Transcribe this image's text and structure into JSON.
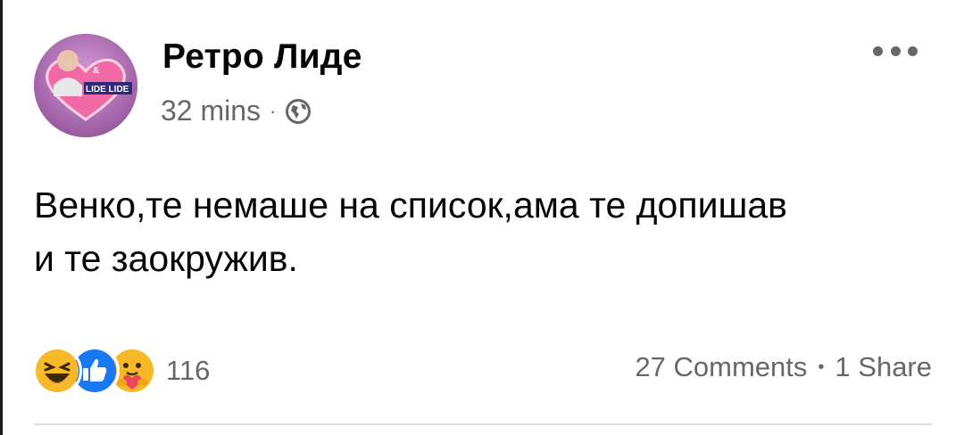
{
  "post": {
    "author": "Ретро Лиде",
    "time": "32 mins",
    "separator": "·",
    "privacy_icon": "globe-icon",
    "text": "Венко,те немаше на список,ама те допишав\nи те заокружив.",
    "avatar_text": {
      "top": "&",
      "label": "LIDE LIDE"
    }
  },
  "reactions": {
    "icons": [
      "laughing-face-icon",
      "like-icon",
      "care-face-icon"
    ],
    "count": "116"
  },
  "stats": {
    "comments": "27 Comments",
    "separator": "•",
    "shares": "1 Share"
  },
  "colors": {
    "secondary_text": "#65676b",
    "like_blue": "#1877f2",
    "reaction_yellow": "#f7b928"
  }
}
